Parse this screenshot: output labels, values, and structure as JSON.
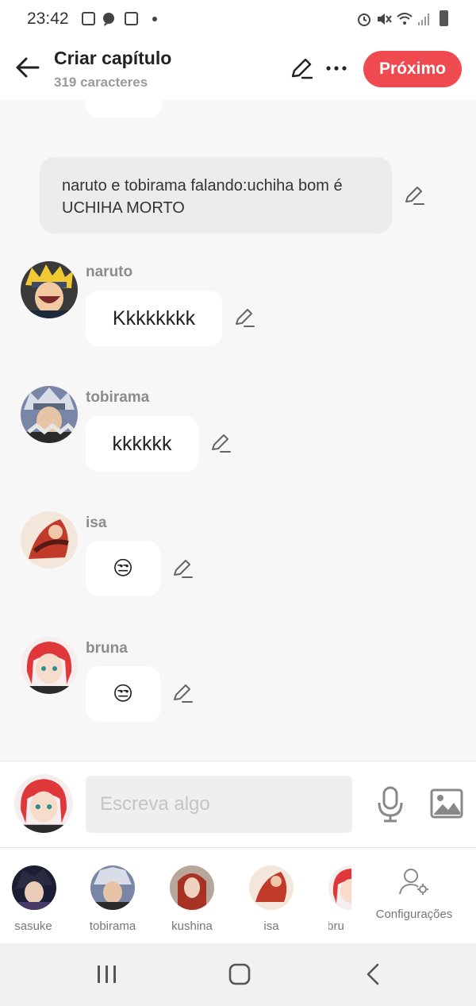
{
  "status": {
    "time": "23:42",
    "left_icons": [
      "image-icon",
      "chat-bubble-icon",
      "app-icon",
      "dot-icon"
    ],
    "right_icons": [
      "alarm-icon",
      "mute-icon",
      "wifi-icon",
      "signal-icon",
      "battery-icon"
    ]
  },
  "header": {
    "title": "Criar capítulo",
    "subtitle": "319 caracteres",
    "next_label": "Próximo"
  },
  "chat": {
    "narration": "naruto e tobirama falando:uchiha bom é UCHIHA MORTO",
    "messages": [
      {
        "name": "naruto",
        "text": "Kkkkkkkk"
      },
      {
        "name": "tobirama",
        "text": "kkkkkk"
      },
      {
        "name": "isa",
        "text": "😒"
      },
      {
        "name": "bruna",
        "text": "😒"
      }
    ]
  },
  "composer": {
    "placeholder": "Escreva algo"
  },
  "characters": {
    "items": [
      "sasuke",
      "tobirama",
      "kushina",
      "isa",
      "bru"
    ],
    "settings_label": "Configurações"
  },
  "colors": {
    "accent": "#ef4a4f",
    "background": "#f7f7f7",
    "bubble": "#ffffff"
  }
}
